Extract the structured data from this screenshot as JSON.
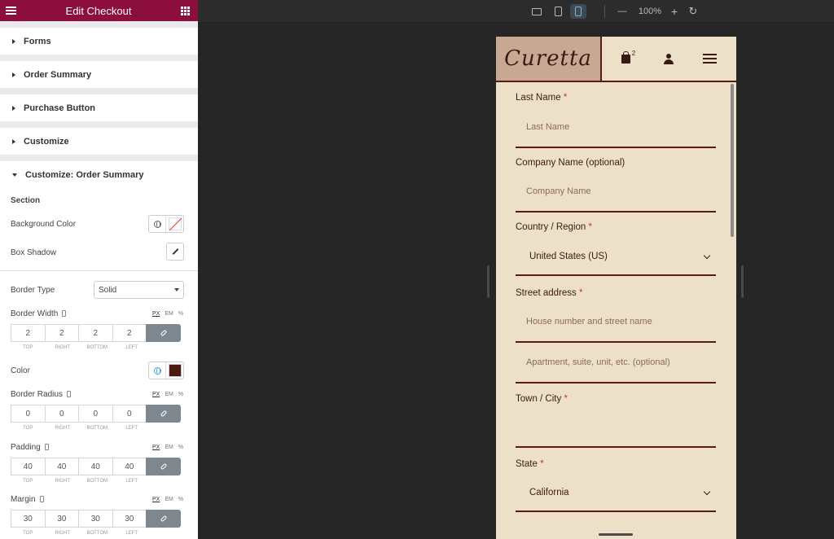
{
  "panel": {
    "title": "Edit Checkout",
    "sections": [
      "Forms",
      "Order Summary",
      "Purchase Button",
      "Customize"
    ],
    "open_section": "Customize: Order Summary",
    "section_heading": "Section",
    "background_color_label": "Background Color",
    "box_shadow_label": "Box Shadow",
    "border_type_label": "Border Type",
    "border_type_value": "Solid",
    "border_width_label": "Border Width",
    "color_label": "Color",
    "color_value": "#4a1a10",
    "border_radius_label": "Border Radius",
    "padding_label": "Padding",
    "margin_label": "Margin",
    "units": [
      "PX",
      "EM",
      "%"
    ],
    "dim_labels": [
      "TOP",
      "RIGHT",
      "BOTTOM",
      "LEFT"
    ],
    "border_width": [
      "2",
      "2",
      "2",
      "2"
    ],
    "border_radius": [
      "0",
      "0",
      "0",
      "0"
    ],
    "padding": [
      "40",
      "40",
      "40",
      "40"
    ],
    "margin": [
      "30",
      "30",
      "30",
      "30"
    ]
  },
  "topbar": {
    "zoom_minus": "—",
    "zoom": "100%",
    "zoom_plus": "+",
    "reset": "↻"
  },
  "site": {
    "logo": "Curetta",
    "cart_count": "2",
    "fields": {
      "last_name_label": "Last Name",
      "last_name_placeholder": "Last Name",
      "company_label": "Company Name (optional)",
      "company_placeholder": "Company Name",
      "country_label": "Country / Region",
      "country_value": "United States (US)",
      "street_label": "Street address",
      "street_placeholder_1": "House number and street name",
      "street_placeholder_2": "Apartment, suite, unit, etc. (optional)",
      "city_label": "Town / City",
      "state_label": "State",
      "state_value": "California",
      "required_mark": "*"
    }
  },
  "colors": {
    "panel_header": "#8c0e3d",
    "site_bg": "#ede0c8",
    "accent_dark": "#5a1a10"
  }
}
